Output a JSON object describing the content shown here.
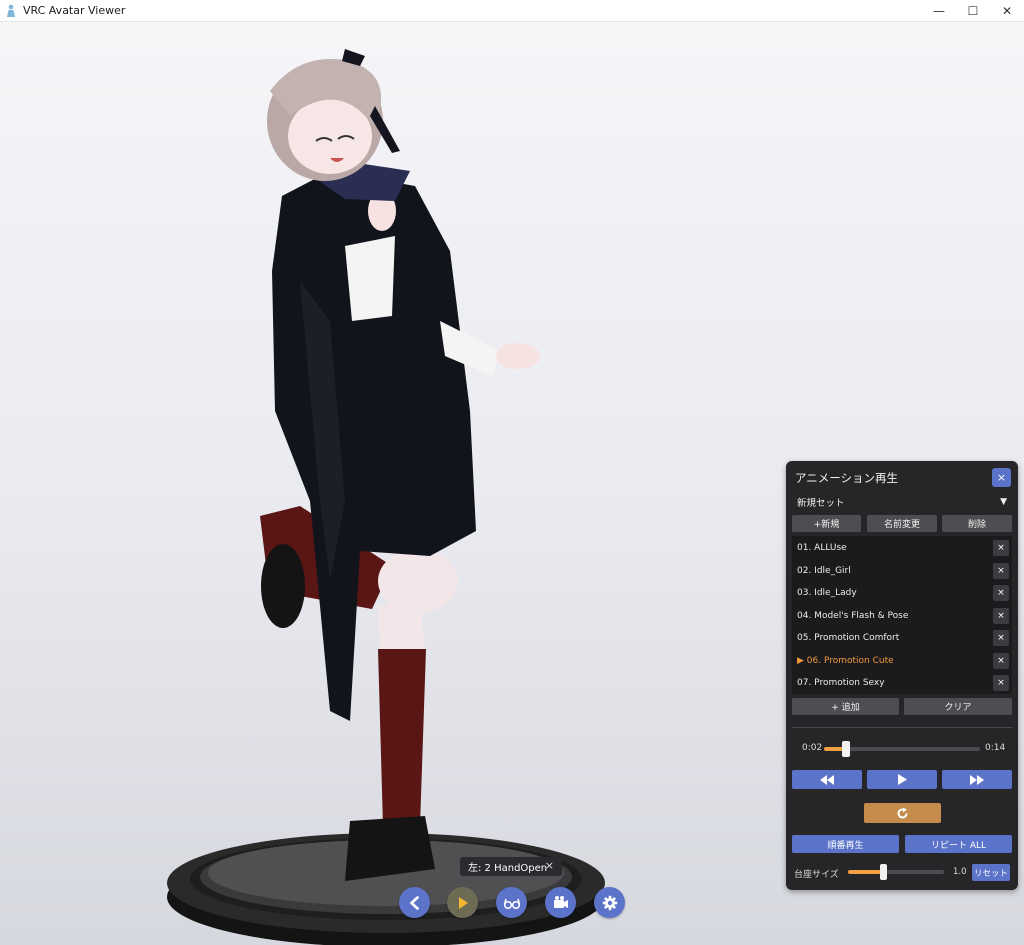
{
  "window": {
    "title": "VRC Avatar Viewer",
    "minimize_glyph": "—",
    "maximize_glyph": "☐",
    "close_glyph": "✕"
  },
  "viewport": {
    "hand_chip": {
      "label": "左: 2 HandOpen",
      "close_glyph": "×"
    },
    "toolbar_icons": [
      "back-icon",
      "play-icon",
      "glasses-icon",
      "camera-icon",
      "gear-icon"
    ]
  },
  "animation_panel": {
    "title": "アニメーション再生",
    "close_glyph": "×",
    "set_name": "新規セット",
    "set_dropdown_glyph": "▼",
    "set_buttons": {
      "new": "+新規",
      "rename": "名前変更",
      "delete": "削除"
    },
    "items": [
      {
        "label": "01. ALLUse",
        "active": false
      },
      {
        "label": "02. Idle_Girl",
        "active": false
      },
      {
        "label": "03. Idle_Lady",
        "active": false
      },
      {
        "label": "04. Model's Flash & Pose",
        "active": false
      },
      {
        "label": "05. Promotion Comfort",
        "active": false
      },
      {
        "label": "▶ 06. Promotion Cute",
        "active": true
      },
      {
        "label": "07. Promotion Sexy",
        "active": false
      }
    ],
    "item_delete_glyph": "×",
    "add_label": "+ 追加",
    "clear_label": "クリア",
    "current_time": "0:02",
    "total_time": "0:14",
    "progress": 0.143,
    "sequential_label": "順番再生",
    "repeat_all_label": "リピート ALL",
    "base_size_label": "台座サイズ",
    "base_size_value": "1.0",
    "base_size_level": 0.37,
    "reset_label": "リセット"
  },
  "colors": {
    "accent_blue": "#5b74c9",
    "accent_orange": "#f0a040",
    "active_item": "#f19a3e",
    "panel_bg": "#262629"
  }
}
